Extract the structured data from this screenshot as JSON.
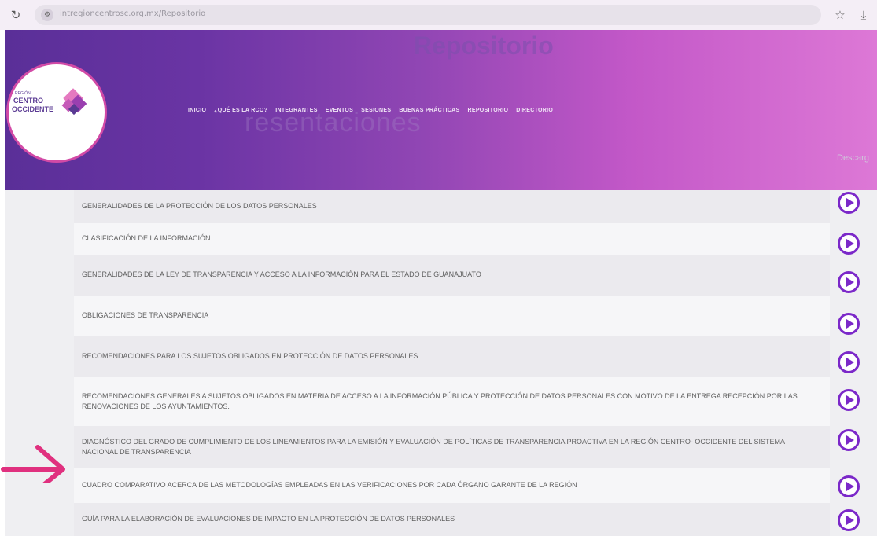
{
  "browser": {
    "url": "intregioncentrosc.org.mx/Repositorio",
    "reload_icon": "reload-icon",
    "site_info_icon": "site-info-icon",
    "star_icon": "star-icon",
    "download_icon": "download-icon"
  },
  "header": {
    "background_title": "Repositorio",
    "background_subtitle": "resentaciones",
    "background_right": "Descarg",
    "logo": {
      "small_text": "REGIÓN",
      "line1": "CENTRO",
      "line2": "OCCIDENTE",
      "border_color": "#d24aa6",
      "text_color": "#5a3a93"
    },
    "nav": [
      {
        "label": "INICIO",
        "active": false
      },
      {
        "label": "¿QUÉ ES LA RCO?",
        "active": false
      },
      {
        "label": "INTEGRANTES",
        "active": false
      },
      {
        "label": "EVENTOS",
        "active": false
      },
      {
        "label": "SESIONES",
        "active": false
      },
      {
        "label": "BUENAS PRÁCTICAS",
        "active": false
      },
      {
        "label": "REPOSITORIO",
        "active": true
      },
      {
        "label": "DIRECTORIO",
        "active": false
      }
    ]
  },
  "repository": {
    "items": [
      {
        "title": "GENERALIDADES DE LA PROTECCIÓN DE LOS DATOS PERSONALES"
      },
      {
        "title": "CLASIFICACIÓN DE LA INFORMACIÓN"
      },
      {
        "title": "GENERALIDADES DE LA LEY DE TRANSPARENCIA Y ACCESO A LA INFORMACIÓN PARA EL ESTADO DE GUANAJUATO"
      },
      {
        "title": "OBLIGACIONES DE TRANSPARENCIA"
      },
      {
        "title": "RECOMENDACIONES PARA LOS SUJETOS OBLIGADOS EN PROTECCIÓN DE DATOS PERSONALES"
      },
      {
        "title": "RECOMENDACIONES GENERALES A SUJETOS OBLIGADOS EN MATERIA DE ACCESO A LA INFORMACIÓN PÚBLICA Y PROTECCIÓN DE DATOS PERSONALES CON MOTIVO DE LA ENTREGA RECEPCIÓN POR LAS RENOVACIONES DE LOS AYUNTAMIENTOS."
      },
      {
        "title": "DIAGNÓSTICO DEL GRADO DE CUMPLIMIENTO DE LOS LINEAMIENTOS PARA LA EMISIÓN Y EVALUACIÓN DE POLÍTICAS DE TRANSPARENCIA PROACTIVA EN LA REGIÓN CENTRO- OCCIDENTE DEL SISTEMA NACIONAL DE TRANSPARENCIA"
      },
      {
        "title": "CUADRO COMPARATIVO ACERCA DE LAS METODOLOGÍAS EMPLEADAS EN LAS VERIFICACIONES POR CADA ÓRGANO GARANTE DE LA REGIÓN"
      },
      {
        "title": "GUÍA PARA LA ELABORACIÓN DE EVALUACIONES DE IMPACTO EN LA PROTECCIÓN DE DATOS PERSONALES"
      }
    ],
    "play_icon": "play-circle-icon"
  },
  "annotation": {
    "icon": "arrow-right-icon"
  },
  "colors": {
    "header_gradient_start": "#5a2f98",
    "header_gradient_end": "#dd78d6",
    "play_accent": "#7b28c9",
    "arrow": "#e0307f",
    "row_shade": "#ebeaee",
    "row_plain": "#f6f6f8",
    "text": "#616161"
  }
}
